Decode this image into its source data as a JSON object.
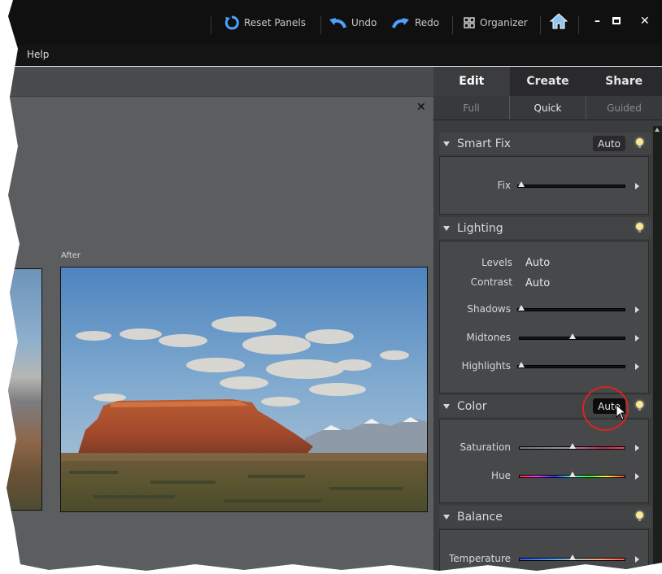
{
  "toolbar": {
    "reset_panels": "Reset Panels",
    "undo": "Undo",
    "redo": "Redo",
    "organizer": "Organizer"
  },
  "menu": {
    "help": "Help"
  },
  "canvas": {
    "after_label": "After"
  },
  "tabs": [
    {
      "label": "Edit"
    },
    {
      "label": "Create"
    },
    {
      "label": "Share"
    }
  ],
  "subtabs": [
    {
      "label": "Full"
    },
    {
      "label": "Quick"
    },
    {
      "label": "Guided"
    }
  ],
  "smart_fix": {
    "title": "Smart Fix",
    "auto_label": "Auto",
    "fix_label": "Fix"
  },
  "lighting": {
    "title": "Lighting",
    "levels_label": "Levels",
    "levels_auto": "Auto",
    "contrast_label": "Contrast",
    "contrast_auto": "Auto",
    "shadows_label": "Shadows",
    "midtones_label": "Midtones",
    "highlights_label": "Highlights"
  },
  "color": {
    "title": "Color",
    "auto_label": "Auto",
    "saturation_label": "Saturation",
    "hue_label": "Hue"
  },
  "balance": {
    "title": "Balance",
    "temperature_label": "Temperature"
  },
  "slider_levels": {
    "fix": 0,
    "shadows": 0,
    "midtones": 50,
    "highlights": 0,
    "saturation": 50,
    "hue": 50,
    "temperature": 50
  },
  "colors": {
    "accent_bulb": "#f6e79a",
    "annotation_circle": "#dd2222"
  }
}
